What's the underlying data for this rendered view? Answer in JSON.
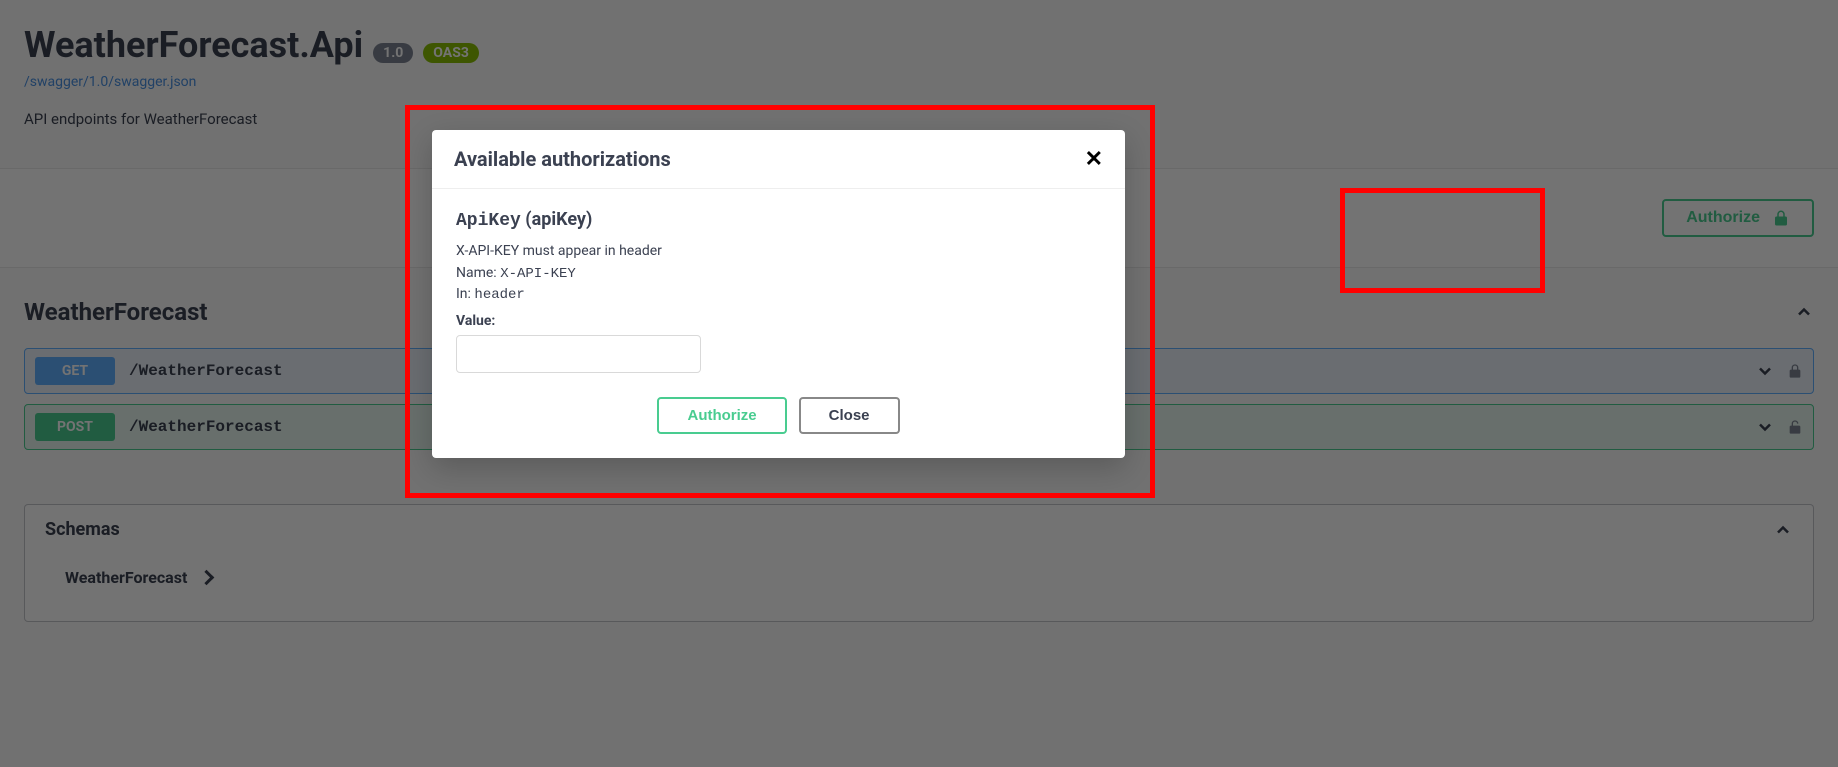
{
  "header": {
    "title": "WeatherForecast.Api",
    "version": "1.0",
    "oas": "OAS3",
    "spec_link": "/swagger/1.0/swagger.json",
    "description": "API endpoints for WeatherForecast"
  },
  "authorize_button": {
    "label": "Authorize"
  },
  "tag": {
    "name": "WeatherForecast"
  },
  "operations": [
    {
      "method": "GET",
      "path": "/WeatherForecast"
    },
    {
      "method": "POST",
      "path": "/WeatherForecast"
    }
  ],
  "schemas_section": {
    "title": "Schemas",
    "items": [
      "WeatherForecast"
    ]
  },
  "modal": {
    "title": "Available authorizations",
    "scheme_name": "ApiKey",
    "scheme_type": "(apiKey)",
    "description": "X-API-KEY must appear in header",
    "name_label": "Name:",
    "name_value": "X-API-KEY",
    "in_label": "In:",
    "in_value": "header",
    "value_label": "Value:",
    "value_input": "",
    "authorize_btn": "Authorize",
    "close_btn": "Close"
  },
  "colors": {
    "accent_green": "#49cc90",
    "get_blue": "#61affe",
    "post_green": "#49cc90",
    "oas_badge": "#89bf04"
  }
}
